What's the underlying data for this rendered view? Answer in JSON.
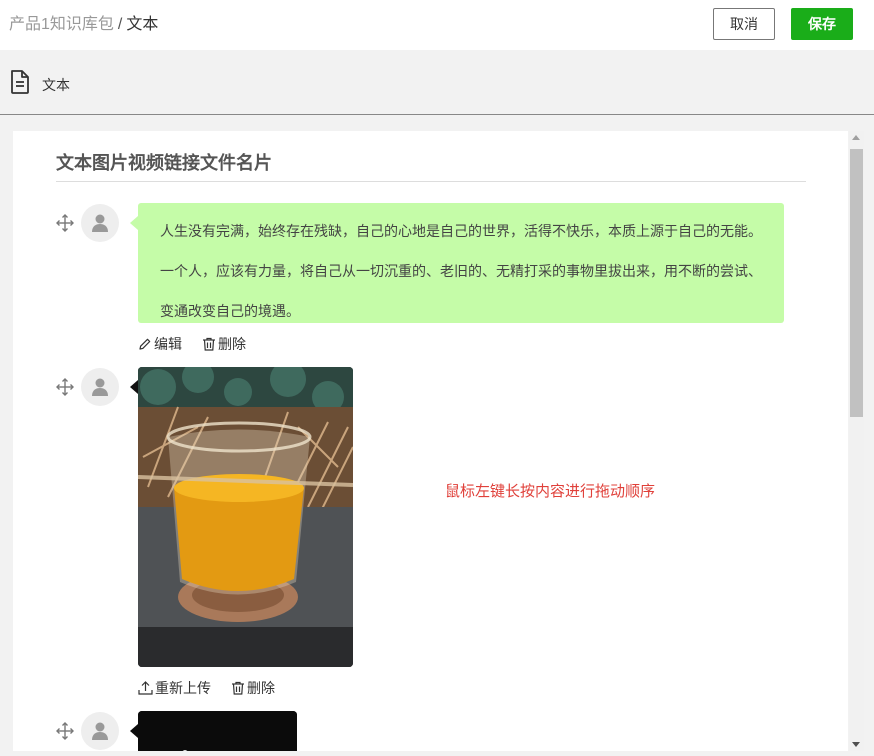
{
  "header": {
    "breadcrumb_parent": "产品1知识库包",
    "breadcrumb_separator": "/",
    "breadcrumb_current": "文本",
    "cancel_label": "取消",
    "save_label": "保存"
  },
  "toolbar": {
    "icon": "document-icon",
    "label": "文本"
  },
  "content": {
    "title": "文本图片视频链接文件名片",
    "items": [
      {
        "type": "text",
        "text": "人生没有完满，始终存在残缺，自己的心地是自己的世界，活得不快乐，本质上源于自己的无能。一个人，应该有力量，将自己从一切沉重的、老旧的、无精打采的事物里拔出来，用不断的尝试、变通改变自己的境遇。",
        "actions": [
          {
            "icon": "pencil-icon",
            "label": "编辑"
          },
          {
            "icon": "trash-icon",
            "label": "删除"
          }
        ]
      },
      {
        "type": "image",
        "image": "tea-glass-photo",
        "actions": [
          {
            "icon": "upload-icon",
            "label": "重新上传"
          },
          {
            "icon": "trash-icon",
            "label": "删除"
          }
        ]
      },
      {
        "type": "image",
        "image": "dark-photo"
      }
    ],
    "hint": "鼠标左键长按内容进行拖动顺序"
  },
  "colors": {
    "save_button": "#1aad19",
    "bubble": "#c5fca8",
    "hint": "#e0403a"
  }
}
